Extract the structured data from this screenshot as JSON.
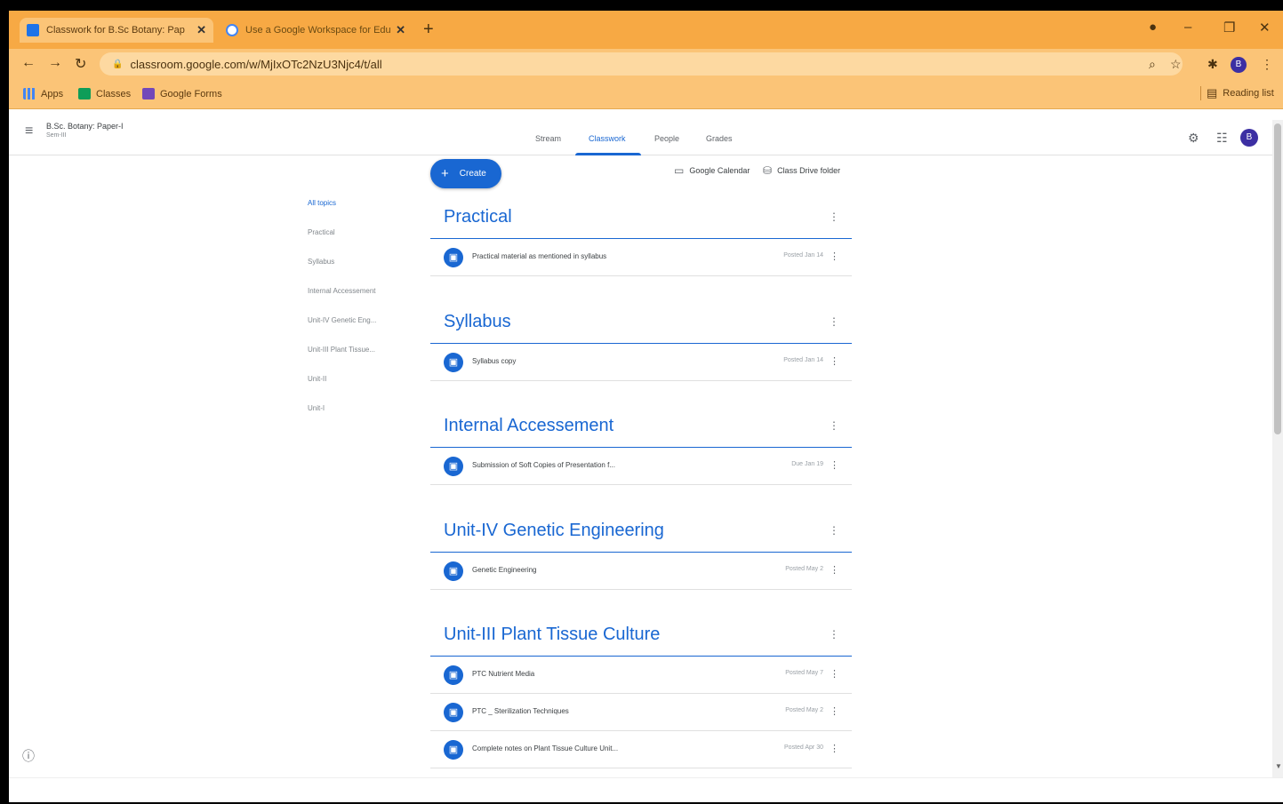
{
  "browser": {
    "tabs": [
      {
        "title": "Classwork for B.Sc Botany: Pap",
        "active": true
      },
      {
        "title": "Use a Google Workspace for Edu",
        "active": false
      }
    ],
    "new_tab": "+",
    "url": "classroom.google.com/w/MjIxOTc2NzU3Njc4/t/all",
    "bookmarks": [
      "Apps",
      "Classes",
      "Google Forms"
    ],
    "reading_list": "Reading list",
    "profile_initial": "B",
    "window_controls": {
      "minimize": "–",
      "maximize": "❐",
      "close": "✕"
    }
  },
  "classroom": {
    "class_name": "B.Sc. Botany: Paper-I",
    "class_section": "Sem-III",
    "tabs": [
      "Stream",
      "Classwork",
      "People",
      "Grades"
    ],
    "active_tab": "Classwork",
    "avatar_initial": "B",
    "create_label": "Create",
    "calendar_link": "Google Calendar",
    "drive_link": "Class Drive folder",
    "topics": [
      "All topics",
      "Practical",
      "Syllabus",
      "Internal Accessement",
      "Unit-IV Genetic Eng...",
      "Unit-III Plant Tissue...",
      "Unit-II",
      "Unit-I"
    ],
    "sections": [
      {
        "title": "Practical",
        "items": [
          {
            "title": "Practical material as mentioned in syllabus",
            "meta": "Posted Jan 14"
          }
        ]
      },
      {
        "title": "Syllabus",
        "items": [
          {
            "title": "Syllabus copy",
            "meta": "Posted Jan 14"
          }
        ]
      },
      {
        "title": "Internal Accessement",
        "items": [
          {
            "title": "Submission of Soft Copies of Presentation f...",
            "meta": "Due Jan 19"
          }
        ]
      },
      {
        "title": "Unit-IV Genetic Engineering",
        "items": [
          {
            "title": "Genetic Engineering",
            "meta": "Posted May 2"
          }
        ]
      },
      {
        "title": "Unit-III Plant Tissue Culture",
        "items": [
          {
            "title": "PTC Nutrient Media",
            "meta": "Posted May 7"
          },
          {
            "title": "PTC _ Sterilization Techniques",
            "meta": "Posted May 2"
          },
          {
            "title": "Complete notes on Plant Tissue Culture Unit...",
            "meta": "Posted Apr 30"
          }
        ]
      }
    ]
  },
  "colors": {
    "accent": "#1967d2",
    "browser_frame": "#f7a944",
    "toolbar": "#fbc477"
  }
}
